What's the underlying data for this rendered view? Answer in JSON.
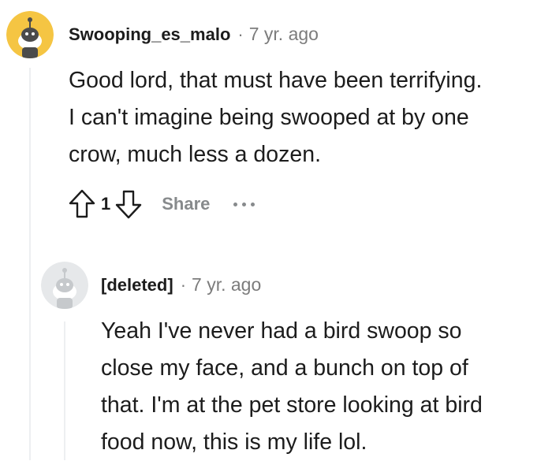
{
  "comment1": {
    "username": "Swooping_es_malo",
    "separator": "·",
    "time": "7 yr. ago",
    "lines": [
      "Good lord, that must have been terrifying.",
      "I can't imagine being swooped at by one",
      "crow, much less a dozen."
    ],
    "actions": {
      "upvote_icon": "upvote-arrow-icon",
      "vote_count": "1",
      "downvote_icon": "downvote-arrow-icon",
      "share_label": "Share",
      "more_icon": "more-options-icon"
    },
    "avatar_color": "#f5c543"
  },
  "comment2": {
    "username": "[deleted]",
    "separator": "·",
    "time": "7 yr. ago",
    "lines": [
      "Yeah I've never had a bird swoop so",
      "close my face, and a bunch on top of",
      "that. I'm at the pet store looking at bird",
      "food now, this is my life lol."
    ],
    "avatar_color": "#e6e8ea"
  }
}
